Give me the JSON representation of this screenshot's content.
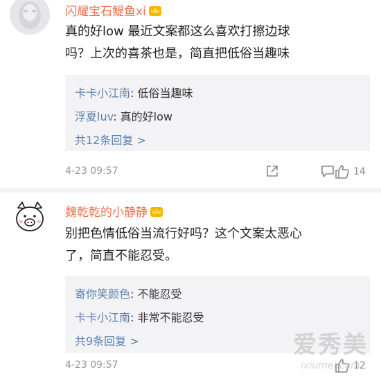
{
  "comments": [
    {
      "username": "闪耀宝石鳀鱼xi",
      "text_line1": "真的好low 最近文案都这么喜欢打擦边球",
      "text_line2": "吗？上次的喜茶也是，简直把低俗当趣味",
      "replies": [
        {
          "user": "卡卡小江南",
          "text": "低俗当趣味"
        },
        {
          "user": "浮夏luv",
          "text": "真的好low"
        }
      ],
      "more_replies": "共12条回复 >",
      "timestamp": "4-23 09:57",
      "like_count": "14",
      "avatar_icon": "blurred-photo-avatar"
    },
    {
      "username": "魏乾乾的小静静",
      "text_line1": "别把色情低俗当流行好吗？这个文案太恶心",
      "text_line2": "了，简直不能忍受。",
      "replies": [
        {
          "user": "寄你笑颜色",
          "text": "不能忍受"
        },
        {
          "user": "卡卡小江南",
          "text": "非常不能忍受"
        }
      ],
      "more_replies": "共9条回复 >",
      "timestamp": "4-23 09:57",
      "like_count": "12",
      "avatar_icon": "pig-cartoon-avatar"
    }
  ],
  "reply_separator": ": ",
  "watermark": {
    "main": "爱秀美",
    "sub": "ixiumei.com"
  },
  "colors": {
    "username": "#eb7350",
    "reply_user": "#5b7fb0",
    "reply_bg": "#f3f3f5",
    "meta_gray": "#999999"
  }
}
